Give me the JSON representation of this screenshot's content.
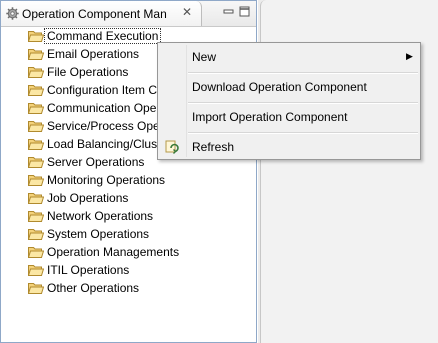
{
  "view": {
    "title": "Operation Component Man",
    "close_symbol": "✕"
  },
  "tree": {
    "items": [
      {
        "label": "Command Execution",
        "selected": true
      },
      {
        "label": "Email Operations"
      },
      {
        "label": "File Operations"
      },
      {
        "label": "Configuration Item C"
      },
      {
        "label": "Communication Ope"
      },
      {
        "label": "Service/Process Oper"
      },
      {
        "label": "Load Balancing/Clus"
      },
      {
        "label": "Server Operations"
      },
      {
        "label": "Monitoring Operations"
      },
      {
        "label": "Job Operations"
      },
      {
        "label": "Network Operations"
      },
      {
        "label": "System Operations"
      },
      {
        "label": "Operation Managements"
      },
      {
        "label": "ITIL Operations"
      },
      {
        "label": "Other Operations"
      }
    ]
  },
  "context_menu": {
    "new_label": "New",
    "download_label": "Download Operation Component",
    "import_label": "Import Operation Component",
    "refresh_label": "Refresh"
  },
  "icons": {
    "view_icon": "gear-icon",
    "folder": "folder-icon",
    "refresh": "refresh-icon",
    "submenu": "chevron-right-icon"
  }
}
